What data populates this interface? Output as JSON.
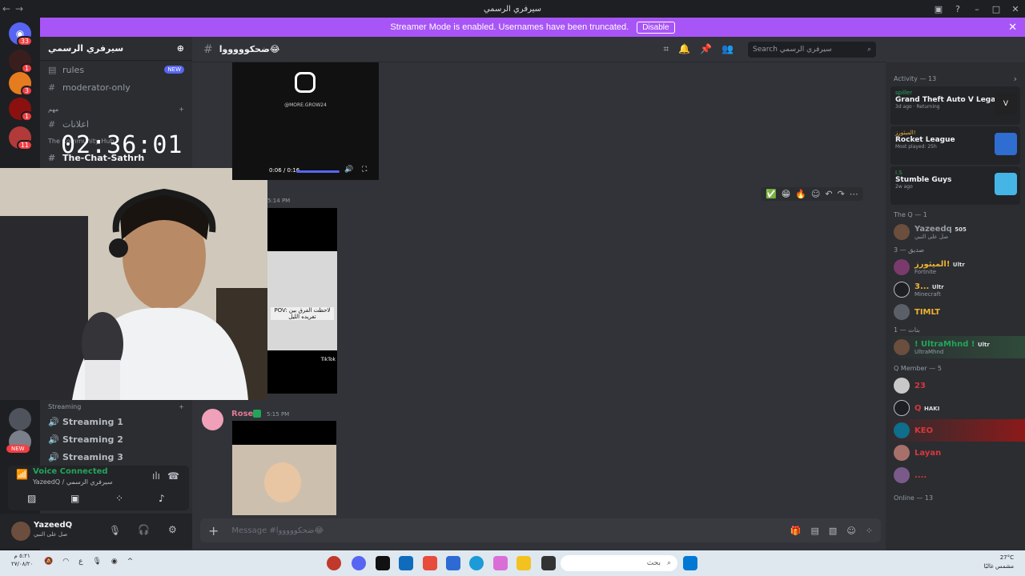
{
  "window": {
    "title": "سيرفري الرسمي"
  },
  "banner": {
    "text": "Streamer Mode is enabled. Usernames have been truncated.",
    "disable_label": "Disable"
  },
  "guilds": {
    "badges": [
      "33",
      "1",
      "3",
      "1",
      "11"
    ]
  },
  "server": {
    "name": "سيرفري الرسمي"
  },
  "channels": {
    "top": [
      {
        "label": "rules",
        "badge": "NEW"
      },
      {
        "label": "moderator-only"
      }
    ],
    "category1": "مهم",
    "announce": "اعلانات",
    "community": "The Community Hub",
    "chat": "The-Chat-Sathrh"
  },
  "timer": "02:36:01",
  "voice_channels": {
    "category": "Streaming",
    "items": [
      "Streaming 1",
      "Streaming 2",
      "Streaming 3"
    ],
    "new_badge": "NEW"
  },
  "voice_status": {
    "title": "Voice Connected",
    "subtitle": "YazeedQ / سيرفري الرسمي"
  },
  "user": {
    "name": "YazeedQ",
    "status": "صل على النبي"
  },
  "chat_header": {
    "channel": "ضحكوووووا😂"
  },
  "search": {
    "placeholder": "Search سيرفري الرسمي"
  },
  "messages": {
    "video1": {
      "handle": "@MORE.GROW24",
      "time": "0:06 / 0:16"
    },
    "msg2_time": "5:14 PM",
    "tiktok_caption": "POV: لاحظت الفرق بين تغريده الليل",
    "tiktok_brand": "TikTok",
    "msg3": {
      "author": "Rose",
      "time": "5:15 PM"
    }
  },
  "composer": {
    "placeholder": "Message #ضحكوووووا😂"
  },
  "members": {
    "activity_title": "Activity — 13",
    "activities": [
      {
        "user": "spiller",
        "game": "Grand Theft Auto V Legacy",
        "meta": "3d ago · Returning"
      },
      {
        "user": "الميثورز!",
        "game": "Rocket League",
        "meta": "Most played: 25h"
      },
      {
        "user": "I.S",
        "game": "Stumble Guys",
        "meta": "2w ago"
      }
    ],
    "group1": "The Q — 1",
    "g1_members": [
      {
        "name": "Yazeedq",
        "tag": "505",
        "sub": "صل على النبي"
      }
    ],
    "group2": "صديق — 3",
    "g2_members": [
      {
        "name": "الميثورز!",
        "tag": "Ultr",
        "sub": "Fortnite"
      },
      {
        "name": "3...",
        "tag": "Ultr",
        "sub": "Minecraft"
      },
      {
        "name": "TIMLT",
        "tag": "",
        "sub": ""
      }
    ],
    "group3": "بنات — 1",
    "g3_members": [
      {
        "name": "! UltraMhnd !",
        "tag": "Ultr",
        "sub": "UltraMhnd"
      }
    ],
    "group4": "Q Member — 5",
    "g4_members": [
      {
        "name": "23",
        "tag": "",
        "sub": ""
      },
      {
        "name": "Q",
        "tag": "HAKI",
        "sub": ""
      },
      {
        "name": "KEO",
        "tag": "",
        "sub": ""
      },
      {
        "name": "Layan",
        "tag": "",
        "sub": ""
      },
      {
        "name": "....",
        "tag": "",
        "sub": ""
      }
    ],
    "online": "Online — 13"
  },
  "taskbar": {
    "search": "بحث",
    "weather": "27°C",
    "weather_sub": "مشمس غالبًا",
    "clock_time": "٥:٢١ م",
    "clock_date": "٢٧/٠٨/٢٠"
  }
}
